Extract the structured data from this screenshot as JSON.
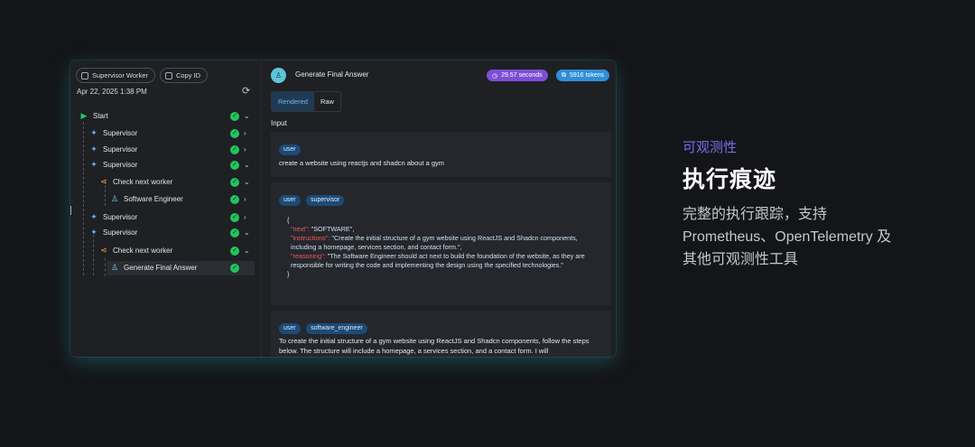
{
  "left": {
    "buttons": [
      "Supervisor Worker",
      "Copy ID"
    ],
    "date": "Apr 22, 2025 1:38 PM",
    "tree": [
      {
        "label": "Start",
        "icon": "play-icon",
        "chev": "⌄"
      },
      {
        "label": "Supervisor",
        "icon": "sparkle-icon",
        "chev": "›"
      },
      {
        "label": "Supervisor",
        "icon": "sparkle-icon",
        "chev": "›"
      },
      {
        "label": "Supervisor",
        "icon": "sparkle-icon",
        "chev": "⌄"
      },
      {
        "label": "Check next worker",
        "icon": "branch-icon",
        "chev": "⌄"
      },
      {
        "label": "Software Engineer",
        "icon": "robot-icon",
        "chev": "›"
      },
      {
        "label": "Supervisor",
        "icon": "sparkle-icon",
        "chev": "›"
      },
      {
        "label": "Supervisor",
        "icon": "sparkle-icon",
        "chev": "⌄"
      },
      {
        "label": "Check next worker",
        "icon": "branch-icon",
        "chev": "⌄"
      },
      {
        "label": "Generate Final Answer",
        "icon": "robot-icon",
        "chev": ""
      }
    ]
  },
  "right": {
    "title": "Generate Final Answer",
    "time_badge": "29.57 seconds",
    "tokens_badge": "5916 tokens",
    "tabs": [
      "Rendered",
      "Raw"
    ],
    "input_label": "Input",
    "card1": {
      "chips": [
        "user"
      ],
      "text": "create a website using reactjs and shadcn about a gym"
    },
    "card2": {
      "chips": [
        "user",
        "supervisor"
      ],
      "open": "{",
      "next_key": "\"next\": ",
      "next_val": "\"SOFTWARE\",",
      "instr_key": "\"instructions\": ",
      "instr_val": "\"Create the initial structure of a gym website using ReactJS and Shadcn components, including a homepage, services section, and contact form.\",",
      "reason_key": "\"reasoning\": ",
      "reason_val": "\"The Software Engineer should act next to build the foundation of the website, as they are responsible for writing the code and implementing the design using the specified technologies.\"",
      "close": "}"
    },
    "card3": {
      "chips": [
        "user",
        "software_engineer"
      ],
      "text": "To create the initial structure of a gym website using ReactJS and Shadcn components, follow the steps below. The structure will include a homepage, a services section, and a contact form. I will"
    }
  },
  "feature": {
    "subtitle": "可观测性",
    "headline": "执行痕迹",
    "description": "完整的执行跟踪，支持 Prometheus、OpenTelemetry 及其他可观测性工具"
  },
  "colors": {
    "accent": "#7b6cf0",
    "success": "#22c55e",
    "chip": "#1c4a78",
    "json_key": "#ef5a5a"
  }
}
